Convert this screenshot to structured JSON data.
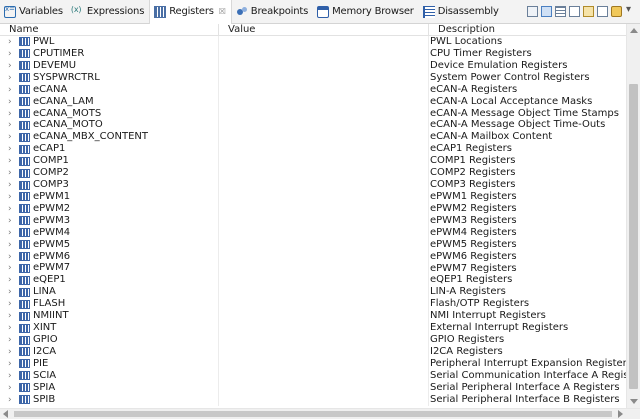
{
  "tabs": [
    {
      "label": "Variables",
      "icon": "variables-icon",
      "active": false
    },
    {
      "label": "Expressions",
      "icon": "expressions-icon",
      "active": false
    },
    {
      "label": "Registers",
      "icon": "registers-icon",
      "active": true
    },
    {
      "label": "Breakpoints",
      "icon": "breakpoints-icon",
      "active": false
    },
    {
      "label": "Memory Browser",
      "icon": "memory-browser-icon",
      "active": false
    },
    {
      "label": "Disassembly",
      "icon": "disassembly-icon",
      "active": false
    }
  ],
  "tab_close_glyph": "☒",
  "columns": {
    "name": "Name",
    "value": "Value",
    "description": "Description"
  },
  "rows": [
    {
      "name": "PWL",
      "value": "",
      "description": "PWL Locations"
    },
    {
      "name": "CPUTIMER",
      "value": "",
      "description": "CPU Timer Registers"
    },
    {
      "name": "DEVEMU",
      "value": "",
      "description": "Device Emulation Registers"
    },
    {
      "name": "SYSPWRCTRL",
      "value": "",
      "description": "System Power Control Registers"
    },
    {
      "name": "eCANA",
      "value": "",
      "description": "eCAN-A  Registers"
    },
    {
      "name": "eCANA_LAM",
      "value": "",
      "description": "eCAN-A Local Acceptance Masks"
    },
    {
      "name": "eCANA_MOTS",
      "value": "",
      "description": "eCAN-A Message Object Time Stamps"
    },
    {
      "name": "eCANA_MOTO",
      "value": "",
      "description": "eCAN-A Message Object Time-Outs"
    },
    {
      "name": "eCANA_MBX_CONTENT",
      "value": "",
      "description": "eCAN-A Mailbox Content"
    },
    {
      "name": "eCAP1",
      "value": "",
      "description": "eCAP1 Registers"
    },
    {
      "name": "COMP1",
      "value": "",
      "description": "COMP1 Registers"
    },
    {
      "name": "COMP2",
      "value": "",
      "description": "COMP2 Registers"
    },
    {
      "name": "COMP3",
      "value": "",
      "description": "COMP3 Registers"
    },
    {
      "name": "ePWM1",
      "value": "",
      "description": "ePWM1 Registers"
    },
    {
      "name": "ePWM2",
      "value": "",
      "description": "ePWM2 Registers"
    },
    {
      "name": "ePWM3",
      "value": "",
      "description": "ePWM3 Registers"
    },
    {
      "name": "ePWM4",
      "value": "",
      "description": "ePWM4 Registers"
    },
    {
      "name": "ePWM5",
      "value": "",
      "description": "ePWM5 Registers"
    },
    {
      "name": "ePWM6",
      "value": "",
      "description": "ePWM6 Registers"
    },
    {
      "name": "ePWM7",
      "value": "",
      "description": "ePWM7 Registers"
    },
    {
      "name": "eQEP1",
      "value": "",
      "description": "eQEP1 Registers"
    },
    {
      "name": "LINA",
      "value": "",
      "description": "LIN-A Registers"
    },
    {
      "name": "FLASH",
      "value": "",
      "description": "Flash/OTP Registers"
    },
    {
      "name": "NMIINT",
      "value": "",
      "description": "NMI Interrupt Registers"
    },
    {
      "name": "XINT",
      "value": "",
      "description": "External Interrupt Registers"
    },
    {
      "name": "GPIO",
      "value": "",
      "description": "GPIO Registers"
    },
    {
      "name": "I2CA",
      "value": "",
      "description": "I2CA Registers"
    },
    {
      "name": "PIE",
      "value": "",
      "description": "Peripheral Interrupt Expansion Registers"
    },
    {
      "name": "SCIA",
      "value": "",
      "description": "Serial Communication Interface A Registers"
    },
    {
      "name": "SPIA",
      "value": "",
      "description": "Serial Peripheral Interface A Registers"
    },
    {
      "name": "SPIB",
      "value": "",
      "description": "Serial Peripheral Interface B Registers"
    }
  ],
  "expand_glyph": "›",
  "toolbar_icons": [
    "toolbar-refresh-icon",
    "toolbar-sync-icon",
    "toolbar-list-icon",
    "toolbar-grid-icon",
    "toolbar-new-group-icon",
    "toolbar-window-icon",
    "toolbar-settings-icon",
    "view-menu-icon"
  ],
  "colors": {
    "register_icon": "#3d66a8",
    "tab_bg": "#f3f3f3",
    "active_tab_bg": "#ffffff"
  }
}
